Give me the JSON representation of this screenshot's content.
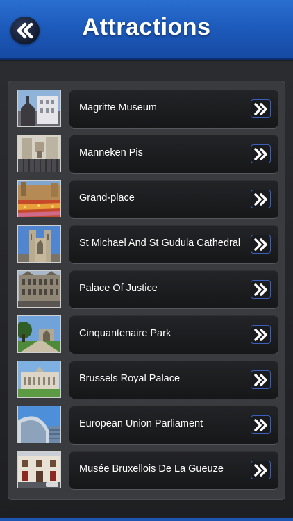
{
  "header": {
    "title": "Attractions",
    "back_icon": "double-chevron-left-icon"
  },
  "list": {
    "items": [
      {
        "label": "Magritte Museum",
        "thumb_icon": "photo-thumbnail",
        "arrow_icon": "double-chevron-right-icon"
      },
      {
        "label": "Manneken Pis",
        "thumb_icon": "photo-thumbnail",
        "arrow_icon": "double-chevron-right-icon"
      },
      {
        "label": "Grand-place",
        "thumb_icon": "photo-thumbnail",
        "arrow_icon": "double-chevron-right-icon"
      },
      {
        "label": "St Michael And St Gudula Cathedral",
        "thumb_icon": "photo-thumbnail",
        "arrow_icon": "double-chevron-right-icon"
      },
      {
        "label": "Palace Of Justice",
        "thumb_icon": "photo-thumbnail",
        "arrow_icon": "double-chevron-right-icon"
      },
      {
        "label": "Cinquantenaire Park",
        "thumb_icon": "photo-thumbnail",
        "arrow_icon": "double-chevron-right-icon"
      },
      {
        "label": "Brussels Royal Palace",
        "thumb_icon": "photo-thumbnail",
        "arrow_icon": "double-chevron-right-icon"
      },
      {
        "label": "European Union Parliament",
        "thumb_icon": "photo-thumbnail",
        "arrow_icon": "double-chevron-right-icon"
      },
      {
        "label": "Musée Bruxellois De La Gueuze",
        "thumb_icon": "photo-thumbnail",
        "arrow_icon": "double-chevron-right-icon"
      }
    ]
  },
  "colors": {
    "header_blue": "#1d5bbc",
    "accent_border": "#3a5fbf",
    "background": "#1b1c1f"
  }
}
